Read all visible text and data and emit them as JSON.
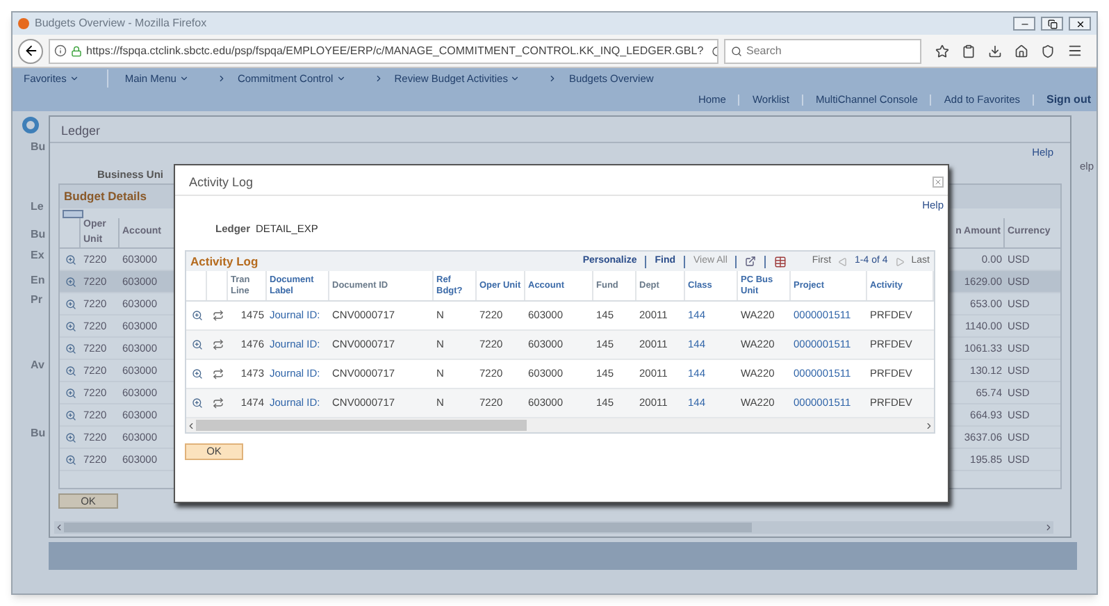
{
  "window": {
    "title": "Budgets Overview - Mozilla Firefox"
  },
  "browser": {
    "url": "https://fspqa.ctclink.sbctc.edu/psp/fspqa/EMPLOYEE/ERP/c/MANAGE_COMMITMENT_CONTROL.KK_INQ_LEDGER.GBL?",
    "search": {
      "placeholder": "Search"
    }
  },
  "nav_menu": [
    {
      "label": "Favorites",
      "kind": "menu"
    },
    {
      "label": "Main Menu",
      "kind": "menu"
    },
    {
      "label": "Commitment Control",
      "kind": "crumb-menu"
    },
    {
      "label": "Review Budget Activities",
      "kind": "crumb-menu"
    },
    {
      "label": "Budgets Overview",
      "kind": "crumb"
    }
  ],
  "header_links": [
    "Home",
    "Worklist",
    "MultiChannel Console",
    "Add to Favorites",
    "Sign out"
  ],
  "background_page": {
    "fragments": [
      "Bu",
      "Le",
      "Bu",
      "Ex",
      "En",
      "Pr",
      "Av",
      "Bu"
    ],
    "help": "elp"
  },
  "ledger_modal": {
    "title": "Ledger",
    "help": "Help",
    "business_unit_label": "Business Uni",
    "budget_details": {
      "title": "Budget Details",
      "columns": [
        "Oper Unit",
        "Account",
        "n Amount",
        "Currency"
      ],
      "rows": [
        {
          "oper_unit": "7220",
          "account": "603000",
          "amount": "0.00",
          "currency": "USD",
          "selected": false
        },
        {
          "oper_unit": "7220",
          "account": "603000",
          "amount": "1629.00",
          "currency": "USD",
          "selected": true
        },
        {
          "oper_unit": "7220",
          "account": "603000",
          "amount": "653.00",
          "currency": "USD",
          "selected": false
        },
        {
          "oper_unit": "7220",
          "account": "603000",
          "amount": "1140.00",
          "currency": "USD",
          "selected": false
        },
        {
          "oper_unit": "7220",
          "account": "603000",
          "amount": "1061.33",
          "currency": "USD",
          "selected": false
        },
        {
          "oper_unit": "7220",
          "account": "603000",
          "amount": "130.12",
          "currency": "USD",
          "selected": false
        },
        {
          "oper_unit": "7220",
          "account": "603000",
          "amount": "65.74",
          "currency": "USD",
          "selected": false
        },
        {
          "oper_unit": "7220",
          "account": "603000",
          "amount": "664.93",
          "currency": "USD",
          "selected": false
        },
        {
          "oper_unit": "7220",
          "account": "603000",
          "amount": "3637.06",
          "currency": "USD",
          "selected": false
        },
        {
          "oper_unit": "7220",
          "account": "603000",
          "amount": "195.85",
          "currency": "USD",
          "selected": false
        }
      ]
    },
    "ok_button": "OK"
  },
  "activity_log_modal": {
    "title": "Activity Log",
    "help": "Help",
    "ledger_label": "Ledger",
    "ledger_value": "DETAIL_EXP",
    "grid": {
      "title": "Activity Log",
      "toolbar": {
        "links": [
          {
            "label": "Personalize",
            "disabled": false
          },
          {
            "label": "Find",
            "disabled": false
          },
          {
            "label": "View All",
            "disabled": true
          }
        ],
        "first": "First",
        "range": "1-4 of 4",
        "last": "Last"
      },
      "columns": [
        {
          "label": "Tran Line",
          "link": false,
          "cell_link": false
        },
        {
          "label": "Document Label",
          "link": true,
          "cell_link": true
        },
        {
          "label": "Document ID",
          "link": false,
          "cell_link": false
        },
        {
          "label": "Ref Bdgt?",
          "link": true,
          "cell_link": false
        },
        {
          "label": "Oper Unit",
          "link": true,
          "cell_link": false
        },
        {
          "label": "Account",
          "link": true,
          "cell_link": false
        },
        {
          "label": "Fund",
          "link": false,
          "cell_link": false
        },
        {
          "label": "Dept",
          "link": false,
          "cell_link": false
        },
        {
          "label": "Class",
          "link": true,
          "cell_link": true
        },
        {
          "label": "PC Bus Unit",
          "link": true,
          "cell_link": false
        },
        {
          "label": "Project",
          "link": true,
          "cell_link": true
        },
        {
          "label": "Activity",
          "link": true,
          "cell_link": false
        }
      ],
      "rows": [
        [
          "1475",
          "Journal ID:",
          "CNV0000717",
          "N",
          "7220",
          "603000",
          "145",
          "20011",
          "144",
          "WA220",
          "0000001511",
          "PRFDEV"
        ],
        [
          "1476",
          "Journal ID:",
          "CNV0000717",
          "N",
          "7220",
          "603000",
          "145",
          "20011",
          "144",
          "WA220",
          "0000001511",
          "PRFDEV"
        ],
        [
          "1473",
          "Journal ID:",
          "CNV0000717",
          "N",
          "7220",
          "603000",
          "145",
          "20011",
          "144",
          "WA220",
          "0000001511",
          "PRFDEV"
        ],
        [
          "1474",
          "Journal ID:",
          "CNV0000717",
          "N",
          "7220",
          "603000",
          "145",
          "20011",
          "144",
          "WA220",
          "0000001511",
          "PRFDEV"
        ]
      ]
    },
    "ok_button": "OK"
  }
}
